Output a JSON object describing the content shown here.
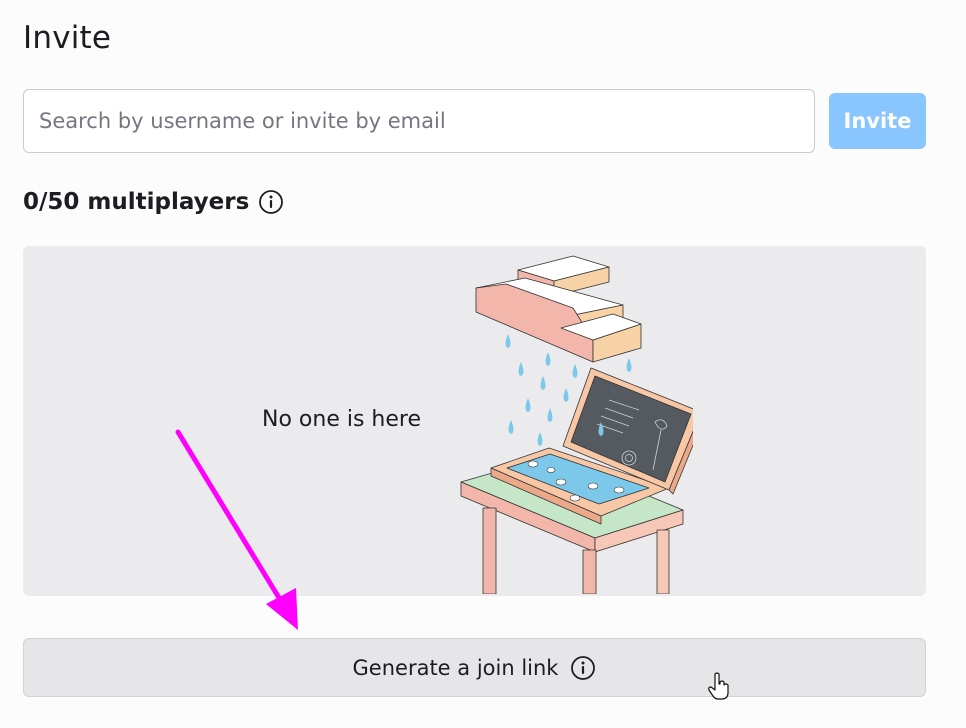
{
  "header": {
    "title": "Invite"
  },
  "search": {
    "placeholder": "Search by username or invite by email",
    "value": ""
  },
  "invite_button": {
    "label": "Invite"
  },
  "multiplayers": {
    "count_text": "0/50 multiplayers",
    "info_icon": "info-icon"
  },
  "empty_state": {
    "message": "No one is here",
    "illustration": "rain-cloud-over-laptop-illustration"
  },
  "join_link": {
    "label": "Generate a join link",
    "info_icon": "info-icon"
  },
  "annotation": {
    "arrow_color": "#ff00ff",
    "icon": "magenta-arrow-icon"
  },
  "colors": {
    "accent": "#89c6ff",
    "panel_bg": "#ebebed",
    "button_bg": "#e6e6e9"
  }
}
